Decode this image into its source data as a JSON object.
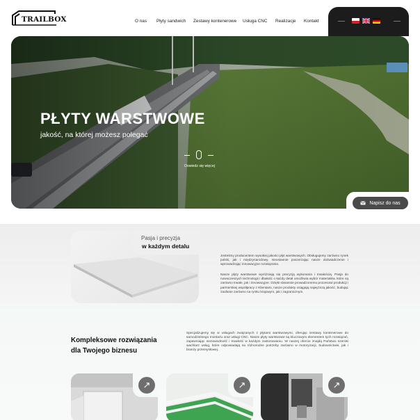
{
  "brand": {
    "logo_text": "TRAILBOX"
  },
  "nav": {
    "items": [
      "O nas",
      "Płyty sandwich",
      "Zestawy kontenerowe",
      "Usługa CNC",
      "Realizacje",
      "Kontakt"
    ]
  },
  "languages": {
    "flags": [
      "pl-flag-icon",
      "uk-flag-icon",
      "de-flag-icon"
    ]
  },
  "hero": {
    "title": "PŁYTY WARSTWOWE",
    "subtitle": "jakość, na której możesz polegać",
    "scroll_label": "Dowiedz się więcej"
  },
  "contact_button": {
    "label": "Napisz do nas",
    "icon": "mail-icon"
  },
  "about": {
    "kicker": "Pasja i precyzja",
    "heading": "w każdym detalu",
    "paragraph1": "Jesteśmy producentem wysokiej jakości płyt warstwowych. Obsługujemy zarówno rynek polski, jak i międzynarodowy, nieustannie poszerzając nasze doświadczenie i wprowadzając innowacyjne rozwiązania.",
    "paragraph2": "Nasze płyty warstwowe wyróżniają się precyzją wykonania i trwałością. Pasja do nowoczesnych technologii i dbałość o każdy detal umożliwia wybór materiałów, które są zarówno trwałe, jak i innowacyjne. Dzięki starannie prowadzonemu procesowi produkcji i partnerskiej współpracy z Klientami, nasze produkty osiągają najwyższą jakość, budując zaufanie zarówno na rynku krajowym, jak i zagranicznym."
  },
  "solutions": {
    "heading_line1": "Kompleksowe rozwiązania",
    "heading_line2": "dla Twojego biznesu",
    "paragraph": "Specjalizujemy się w usługach związanych z płytami warstwowymi, oferując zestawy kontenerowe do samodzielnego montażu oraz usługi CNC. Nasze płyty warstwowe są kluczowym elementem tych rozwiązań, zapewniając niezawodność i trwałość w każdym zastosowaniu. W naszej ofercie znajdą Państwo szeroki wachlarz usług, które odpowiadają na różnorodne potrzeby zarówno w motoryzacji, budownictwie, jak i branży przemysłowej.",
    "tiles": [
      {
        "arrow": "↗"
      },
      {
        "arrow": "↗"
      },
      {
        "arrow": "↗"
      }
    ]
  },
  "colors": {
    "accent_dark": "#4a4a4a",
    "hero_dark": "#1c1c1c",
    "flag_red": "#d71f26"
  }
}
